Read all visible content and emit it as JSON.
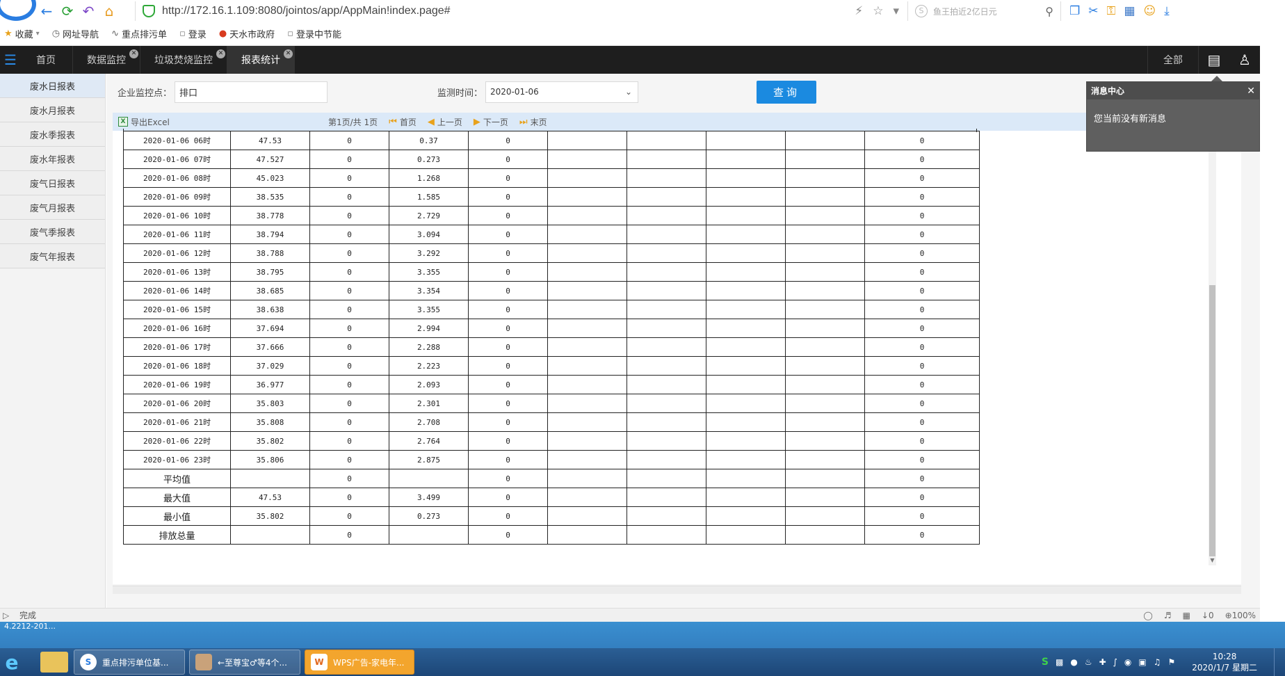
{
  "browser": {
    "url": "http://172.16.1.109:8080/jointos/app/AppMain!index.page#",
    "search_placeholder": "鱼王拍近2亿日元",
    "bookmarks": [
      "收藏",
      "网址导航",
      "重点排污单",
      "登录",
      "天水市政府",
      "登录中节能"
    ]
  },
  "header": {
    "tabs": [
      {
        "label": "首页",
        "closable": false
      },
      {
        "label": "数据监控",
        "closable": true
      },
      {
        "label": "垃圾焚烧监控",
        "closable": true
      },
      {
        "label": "报表统计",
        "closable": true,
        "active": true
      }
    ],
    "all_label": "全部"
  },
  "sidebar": {
    "items": [
      "废水日报表",
      "废水月报表",
      "废水季报表",
      "废水年报表",
      "废气日报表",
      "废气月报表",
      "废气季报表",
      "废气年报表"
    ],
    "active_index": 0
  },
  "filter": {
    "enterprise_label": "企业监控点：",
    "enterprise_value": "排口",
    "time_label": "监测时间：",
    "time_value": "2020-01-06",
    "query_label": "查询"
  },
  "toolbar": {
    "export_label": "导出Excel",
    "page_info": "第1页/共 1页",
    "first": "首页",
    "prev": "上一页",
    "next": "下一页",
    "last": "末页"
  },
  "table": {
    "rows": [
      [
        "2020-01-06  06时",
        "47.53",
        "0",
        "0.37",
        "0",
        "",
        "",
        "",
        "",
        "0"
      ],
      [
        "2020-01-06  07时",
        "47.527",
        "0",
        "0.273",
        "0",
        "",
        "",
        "",
        "",
        "0"
      ],
      [
        "2020-01-06  08时",
        "45.023",
        "0",
        "1.268",
        "0",
        "",
        "",
        "",
        "",
        "0"
      ],
      [
        "2020-01-06  09时",
        "38.535",
        "0",
        "1.585",
        "0",
        "",
        "",
        "",
        "",
        "0"
      ],
      [
        "2020-01-06  10时",
        "38.778",
        "0",
        "2.729",
        "0",
        "",
        "",
        "",
        "",
        "0"
      ],
      [
        "2020-01-06  11时",
        "38.794",
        "0",
        "3.094",
        "0",
        "",
        "",
        "",
        "",
        "0"
      ],
      [
        "2020-01-06  12时",
        "38.788",
        "0",
        "3.292",
        "0",
        "",
        "",
        "",
        "",
        "0"
      ],
      [
        "2020-01-06  13时",
        "38.795",
        "0",
        "3.355",
        "0",
        "",
        "",
        "",
        "",
        "0"
      ],
      [
        "2020-01-06  14时",
        "38.685",
        "0",
        "3.354",
        "0",
        "",
        "",
        "",
        "",
        "0"
      ],
      [
        "2020-01-06  15时",
        "38.638",
        "0",
        "3.355",
        "0",
        "",
        "",
        "",
        "",
        "0"
      ],
      [
        "2020-01-06  16时",
        "37.694",
        "0",
        "2.994",
        "0",
        "",
        "",
        "",
        "",
        "0"
      ],
      [
        "2020-01-06  17时",
        "37.666",
        "0",
        "2.288",
        "0",
        "",
        "",
        "",
        "",
        "0"
      ],
      [
        "2020-01-06  18时",
        "37.029",
        "0",
        "2.223",
        "0",
        "",
        "",
        "",
        "",
        "0"
      ],
      [
        "2020-01-06  19时",
        "36.977",
        "0",
        "2.093",
        "0",
        "",
        "",
        "",
        "",
        "0"
      ],
      [
        "2020-01-06  20时",
        "35.803",
        "0",
        "2.301",
        "0",
        "",
        "",
        "",
        "",
        "0"
      ],
      [
        "2020-01-06  21时",
        "35.808",
        "0",
        "2.708",
        "0",
        "",
        "",
        "",
        "",
        "0"
      ],
      [
        "2020-01-06  22时",
        "35.802",
        "0",
        "2.764",
        "0",
        "",
        "",
        "",
        "",
        "0"
      ],
      [
        "2020-01-06  23时",
        "35.806",
        "0",
        "2.875",
        "0",
        "",
        "",
        "",
        "",
        "0"
      ]
    ],
    "summary": [
      [
        "平均值",
        "",
        "0",
        "",
        "0",
        "",
        "",
        "",
        "",
        "0"
      ],
      [
        "最大值",
        "47.53",
        "0",
        "3.499",
        "0",
        "",
        "",
        "",
        "",
        "0"
      ],
      [
        "最小值",
        "35.802",
        "0",
        "0.273",
        "0",
        "",
        "",
        "",
        "",
        "0"
      ],
      [
        "排放总量",
        "",
        "0",
        "",
        "0",
        "",
        "",
        "",
        "",
        "0"
      ]
    ]
  },
  "message_center": {
    "title": "消息中心",
    "body": "您当前没有新消息"
  },
  "status": {
    "text": "完成",
    "downloads": "0",
    "zoom": "100%"
  },
  "taskbar": {
    "desktop_text": "4.2212-201...",
    "items": [
      "重点排污单位基...",
      "←至尊宝♂等4个...",
      "WPS广告-家电年..."
    ],
    "time": "10:28",
    "date": "2020/1/7 星期二"
  },
  "colors": {
    "header_bg": "#1e1e1e",
    "accent": "#1b8ae0",
    "toolbar_bg": "#dbe9f8",
    "popup_bg": "#5f5f5f"
  }
}
